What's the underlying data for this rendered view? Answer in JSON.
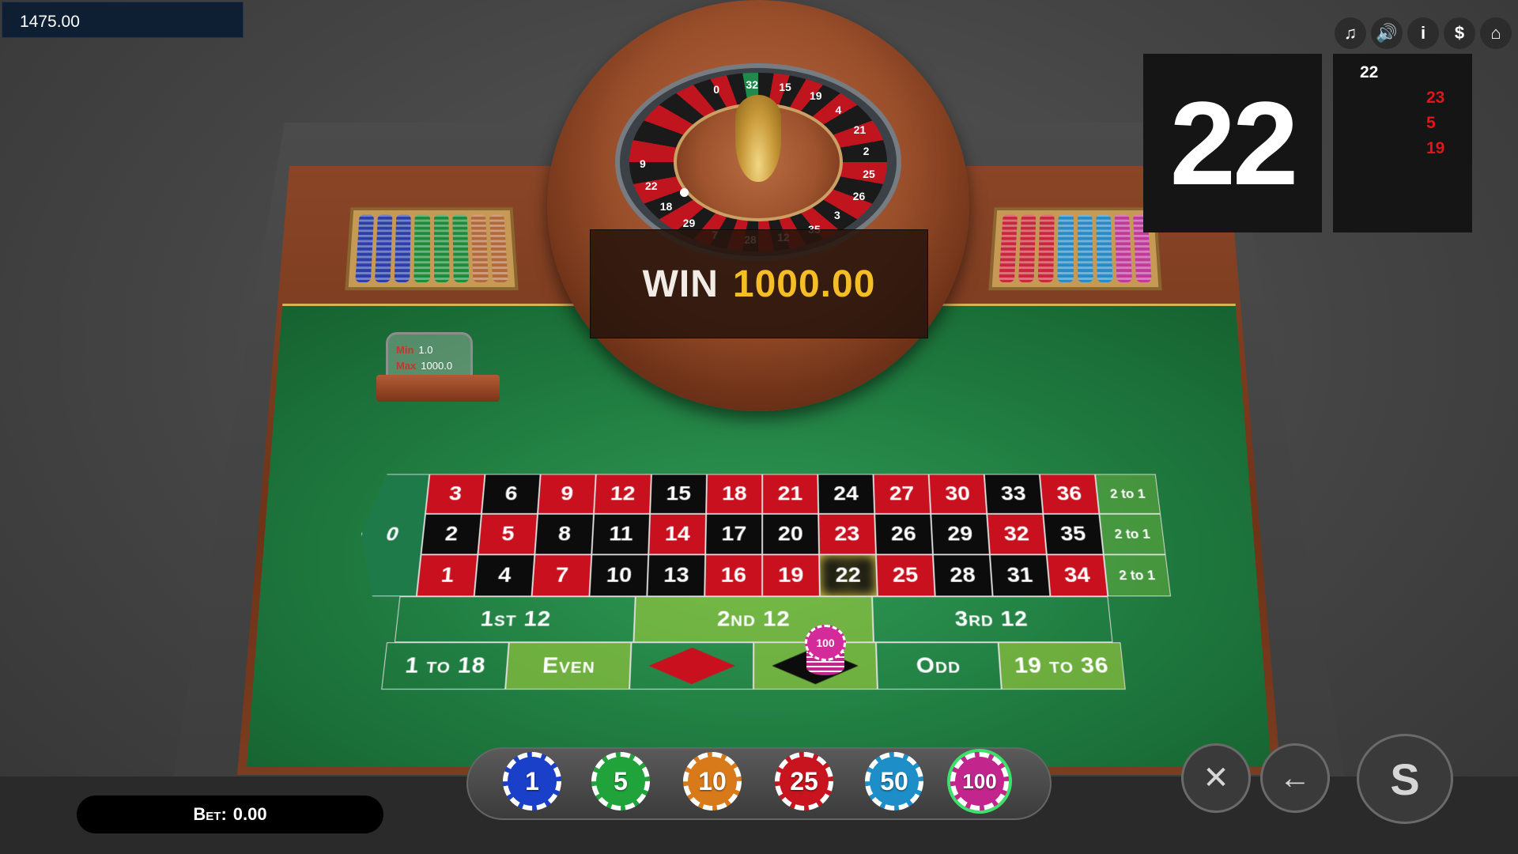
{
  "balance": "1475.00",
  "win": {
    "label": "WIN",
    "amount": "1000.00"
  },
  "last_result": "22",
  "history": [
    {
      "value": "22",
      "color": "black"
    },
    {
      "value": "23",
      "color": "red"
    },
    {
      "value": "5",
      "color": "red"
    },
    {
      "value": "19",
      "color": "red"
    }
  ],
  "limits": {
    "min_label": "Min",
    "min": "1.0",
    "max_label": "Max",
    "max": "1000.0"
  },
  "top_icons": [
    {
      "name": "music-icon",
      "glyph": "♫"
    },
    {
      "name": "sound-icon",
      "glyph": "🔊"
    },
    {
      "name": "info-icon",
      "glyph": "i"
    },
    {
      "name": "dollar-icon",
      "glyph": "$"
    },
    {
      "name": "home-icon",
      "glyph": "⌂"
    }
  ],
  "board": {
    "zero": "0",
    "rows": [
      [
        "3",
        "6",
        "9",
        "12",
        "15",
        "18",
        "21",
        "24",
        "27",
        "30",
        "33",
        "36"
      ],
      [
        "2",
        "5",
        "8",
        "11",
        "14",
        "17",
        "20",
        "23",
        "26",
        "29",
        "32",
        "35"
      ],
      [
        "1",
        "4",
        "7",
        "10",
        "13",
        "16",
        "19",
        "22",
        "25",
        "28",
        "31",
        "34"
      ]
    ],
    "red_numbers": [
      "1",
      "3",
      "5",
      "7",
      "9",
      "12",
      "14",
      "16",
      "18",
      "19",
      "21",
      "23",
      "25",
      "27",
      "30",
      "32",
      "34",
      "36"
    ],
    "highlighted": "22",
    "columns": [
      "2 to 1",
      "2 to 1",
      "2 to 1"
    ],
    "dozens": [
      "1st 12",
      "2nd 12",
      "3rd 12"
    ],
    "outside": {
      "low": "1 to 18",
      "even": "Even",
      "odd": "Odd",
      "high": "19 to 36"
    },
    "bet_chip": "100"
  },
  "wheel_labels": [
    "0",
    "32",
    "15",
    "19",
    "4",
    "21",
    "2",
    "25",
    "26",
    "3",
    "35",
    "12",
    "28",
    "7",
    "29",
    "18",
    "22",
    "9"
  ],
  "bet": {
    "label": "Bet:",
    "value": "0.00"
  },
  "chips": [
    {
      "value": "1",
      "color": "#1a3fc8"
    },
    {
      "value": "5",
      "color": "#1fa33a"
    },
    {
      "value": "10",
      "color": "#d97a1a"
    },
    {
      "value": "25",
      "color": "#c8141e"
    },
    {
      "value": "50",
      "color": "#1e8ec8"
    },
    {
      "value": "100",
      "color": "#c2268c"
    }
  ],
  "selected_chip": "100",
  "controls": {
    "clear": "✕",
    "undo": "←",
    "spin": "S"
  }
}
